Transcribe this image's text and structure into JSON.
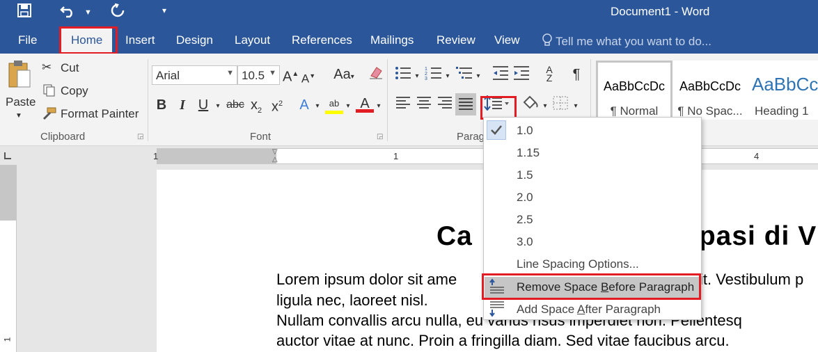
{
  "window": {
    "title": "Document1 - Word"
  },
  "tabs": [
    {
      "label": "File"
    },
    {
      "label": "Home"
    },
    {
      "label": "Insert"
    },
    {
      "label": "Design"
    },
    {
      "label": "Layout"
    },
    {
      "label": "References"
    },
    {
      "label": "Mailings"
    },
    {
      "label": "Review"
    },
    {
      "label": "View"
    }
  ],
  "tellme": {
    "placeholder": "Tell me what you want to do..."
  },
  "clipboard": {
    "paste": "Paste",
    "cut": "Cut",
    "copy": "Copy",
    "format_painter": "Format Painter",
    "group": "Clipboard"
  },
  "font": {
    "name": "Arial",
    "size": "10.5",
    "aa": "Aa",
    "group": "Font"
  },
  "paragraph": {
    "group": "Parag"
  },
  "styles": [
    {
      "sample": "AaBbCcDc",
      "name": "¶ Normal"
    },
    {
      "sample": "AaBbCcDc",
      "name": "¶ No Spac..."
    },
    {
      "sample": "AaBbCc",
      "name": "Heading 1"
    }
  ],
  "ruler": {
    "left": "1",
    "mid": "1",
    "right": "4"
  },
  "vruler": {
    "bottom": "1"
  },
  "document": {
    "heading_left": "Ca",
    "heading_right": "pasi di V",
    "line1_left": "Lorem ipsum dolor sit ame",
    "line1_right": "it. Vestibulum p",
    "line2": "ligula nec, laoreet nisl.",
    "line3_left": "Nullam convallis arcu nulla, eu varius risus imperdiet non. Pellentesq",
    "line4": "auctor vitae at nunc. Proin a fringilla diam. Sed vitae faucibus arcu."
  },
  "line_spacing_menu": {
    "options": [
      "1.0",
      "1.15",
      "1.5",
      "2.0",
      "2.5",
      "3.0"
    ],
    "checked_index": 0,
    "more": "Line Spacing Options...",
    "remove_before_a": "Remove Space ",
    "remove_before_b": "B",
    "remove_before_c": "efore Paragraph",
    "add_after_a": "Add Space ",
    "add_after_b": "A",
    "add_after_c": "fter Paragraph"
  },
  "colors": {
    "word_blue": "#2b579a",
    "highlight": "#e31b23",
    "yellow": "#ffff00",
    "red": "#e31b23"
  }
}
